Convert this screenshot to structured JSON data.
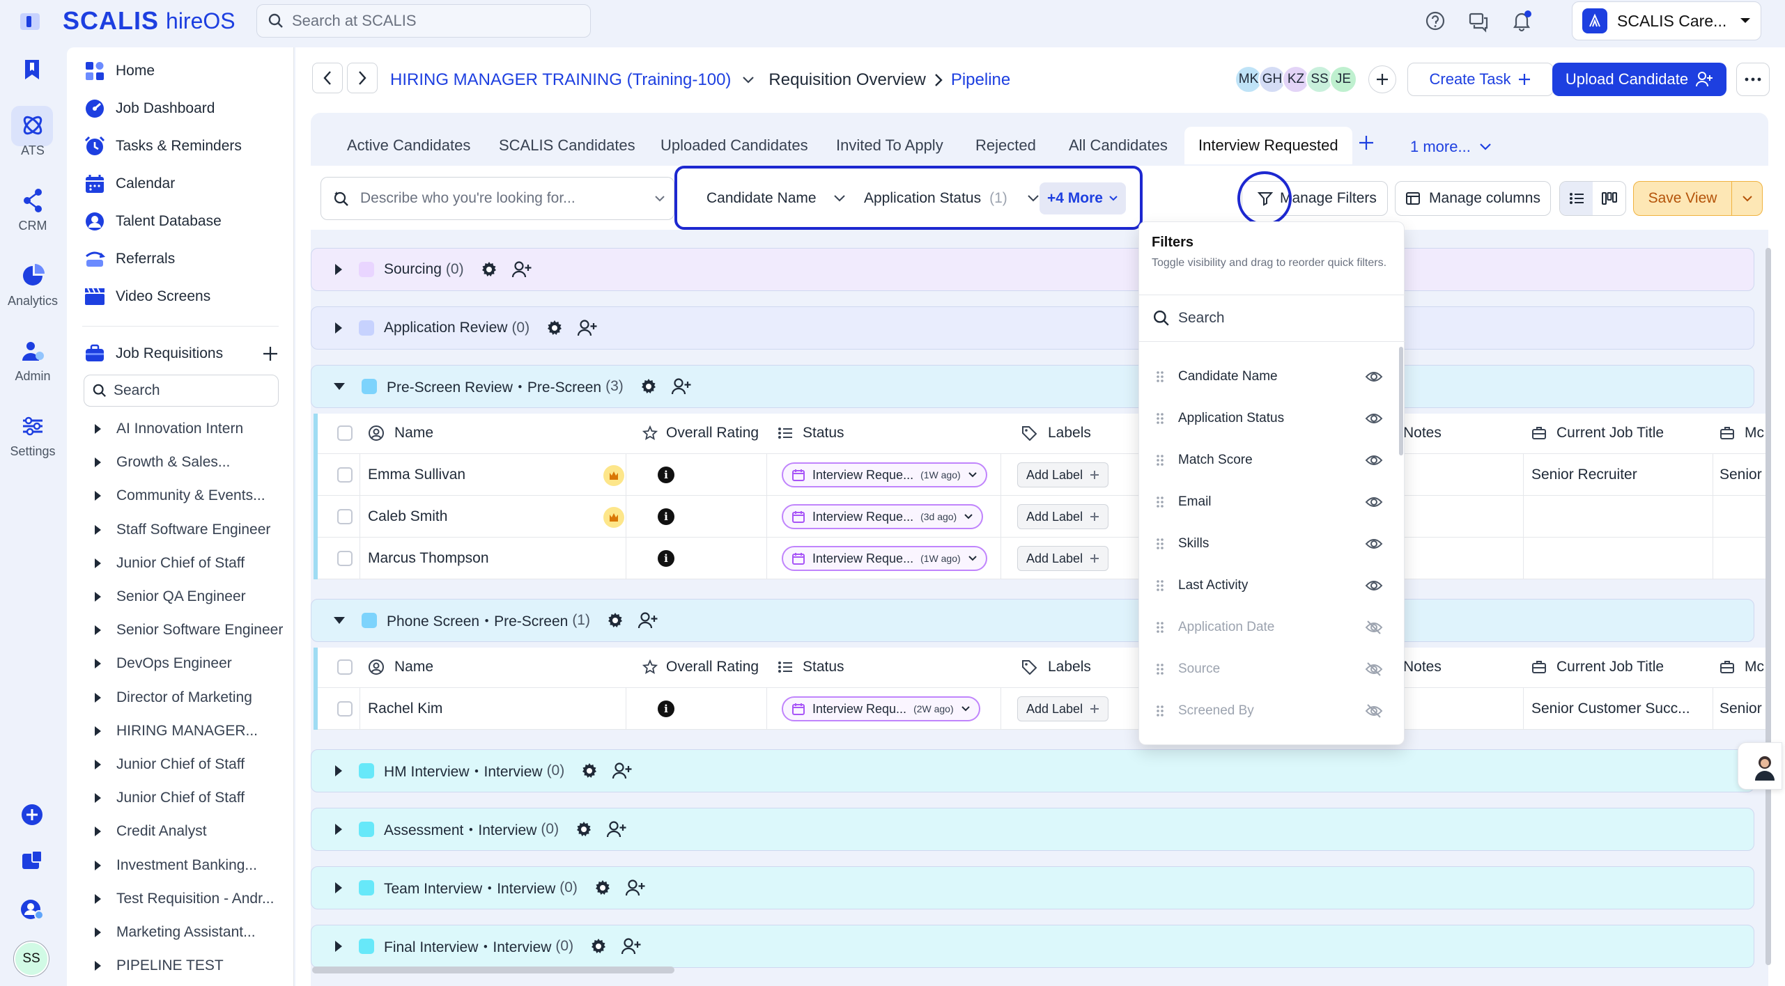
{
  "app": {
    "brand": "SCALIS",
    "product": "hireOS",
    "search_placeholder": "Search at SCALIS",
    "org_name": "SCALIS Care..."
  },
  "rail": [
    {
      "label": "ATS",
      "icon": "ats-icon"
    },
    {
      "label": "CRM",
      "icon": "crm-icon"
    },
    {
      "label": "Analytics",
      "icon": "analytics-icon"
    },
    {
      "label": "Admin",
      "icon": "admin-icon"
    },
    {
      "label": "Settings",
      "icon": "settings-icon"
    }
  ],
  "user_initials": "SS",
  "sidebar": {
    "nav": [
      "Home",
      "Job Dashboard",
      "Tasks & Reminders",
      "Calendar",
      "Talent Database",
      "Referrals",
      "Video Screens"
    ],
    "requisitions_title": "Job Requisitions",
    "search_placeholder": "Search",
    "requisitions": [
      "AI Innovation Intern",
      "Growth & Sales...",
      "Community & Events...",
      "Staff Software Engineer",
      "Junior Chief of Staff",
      "Senior QA Engineer",
      "Senior Software Engineer",
      "DevOps Engineer",
      "Director of Marketing",
      "HIRING MANAGER...",
      "Junior Chief of Staff",
      "Junior Chief of Staff",
      "Credit Analyst",
      "Investment Banking...",
      "Test Requisition - Andr...",
      "Marketing Assistant...",
      "PIPELINE TEST"
    ]
  },
  "header": {
    "requisition": "HIRING MANAGER TRAINING (Training-100)",
    "overview": "Requisition Overview",
    "current": "Pipeline",
    "avatars": [
      {
        "initials": "MK",
        "color": "#bfe3f7"
      },
      {
        "initials": "GH",
        "color": "#d4dcf5"
      },
      {
        "initials": "KZ",
        "color": "#e3d4f7"
      },
      {
        "initials": "SS",
        "color": "#c9f0dc"
      },
      {
        "initials": "JE",
        "color": "#bff0cf"
      }
    ],
    "create_task": "Create Task",
    "upload_candidate": "Upload Candidate"
  },
  "tabs": [
    "Active Candidates",
    "SCALIS Candidates",
    "Uploaded Candidates",
    "Invited To Apply",
    "Rejected",
    "All Candidates",
    "Interview Requested"
  ],
  "tabs_more": "1 more...",
  "filters": {
    "describe_placeholder": "Describe who you're looking for...",
    "quick": [
      {
        "label": "Candidate Name",
        "count": ""
      },
      {
        "label": "Application Status",
        "count": "(1)"
      }
    ],
    "more": "+4 More",
    "manage_filters": "Manage Filters",
    "manage_columns": "Manage columns",
    "save_view": "Save View"
  },
  "stages": [
    {
      "name": "Sourcing",
      "count": "(0)",
      "color": "#e9d5ff",
      "bg": "#f1ebfd",
      "expanded": false
    },
    {
      "name": "Application Review",
      "count": "(0)",
      "color": "#c7d2fe",
      "bg": "#e9edfd",
      "expanded": false
    },
    {
      "name": "Pre-Screen Review・Pre-Screen",
      "count": "(3)",
      "color": "#7dd3fc",
      "bg": "#dff3fc",
      "expanded": true
    },
    {
      "name": "Phone Screen・Pre-Screen",
      "count": "(1)",
      "color": "#7dd3fc",
      "bg": "#dff3fc",
      "expanded": true
    },
    {
      "name": "HM Interview・Interview",
      "count": "(0)",
      "color": "#67e8f9",
      "bg": "#dcf8fb",
      "expanded": false
    },
    {
      "name": "Assessment・Interview",
      "count": "(0)",
      "color": "#67e8f9",
      "bg": "#dcf8fb",
      "expanded": false
    },
    {
      "name": "Team Interview・Interview",
      "count": "(0)",
      "color": "#67e8f9",
      "bg": "#dcf8fb",
      "expanded": false
    },
    {
      "name": "Final Interview・Interview",
      "count": "(0)",
      "color": "#67e8f9",
      "bg": "#dcf8fb",
      "expanded": false
    }
  ],
  "columns": {
    "name": "Name",
    "rating": "Overall Rating",
    "status": "Status",
    "labels": "Labels",
    "notes": "Notes",
    "job_title": "Current Job Title",
    "company": "Mc"
  },
  "tables": [
    {
      "rows": [
        {
          "name": "Emma Sullivan",
          "badge": true,
          "status": "Interview Reque...",
          "ago": "(1W ago)",
          "label": "Add Label",
          "job_title": "Senior Recruiter",
          "company": "Senior"
        },
        {
          "name": "Caleb Smith",
          "badge": true,
          "status": "Interview Reque...",
          "ago": "(3d ago)",
          "label": "Add Label",
          "job_title": "",
          "company": ""
        },
        {
          "name": "Marcus Thompson",
          "badge": false,
          "status": "Interview Reque...",
          "ago": "(1W ago)",
          "label": "Add Label",
          "job_title": "",
          "company": ""
        }
      ]
    },
    {
      "rows": [
        {
          "name": "Rachel Kim",
          "badge": false,
          "status": "Interview Requ...",
          "ago": "(2W ago)",
          "label": "Add Label",
          "job_title": "Senior Customer Succ...",
          "company": "Senior"
        }
      ]
    }
  ],
  "filters_panel": {
    "title": "Filters",
    "subtitle": "Toggle visibility and drag to reorder quick filters.",
    "search_placeholder": "Search",
    "items": [
      {
        "label": "Candidate Name",
        "visible": true
      },
      {
        "label": "Application Status",
        "visible": true
      },
      {
        "label": "Match Score",
        "visible": true
      },
      {
        "label": "Email",
        "visible": true
      },
      {
        "label": "Skills",
        "visible": true
      },
      {
        "label": "Last Activity",
        "visible": true
      },
      {
        "label": "Application Date",
        "visible": false
      },
      {
        "label": "Source",
        "visible": false
      },
      {
        "label": "Screened By",
        "visible": false
      }
    ]
  },
  "colors": {
    "accent": "#1d3fe0",
    "highlight": "#1d28d0",
    "save": "#fde7b5"
  }
}
